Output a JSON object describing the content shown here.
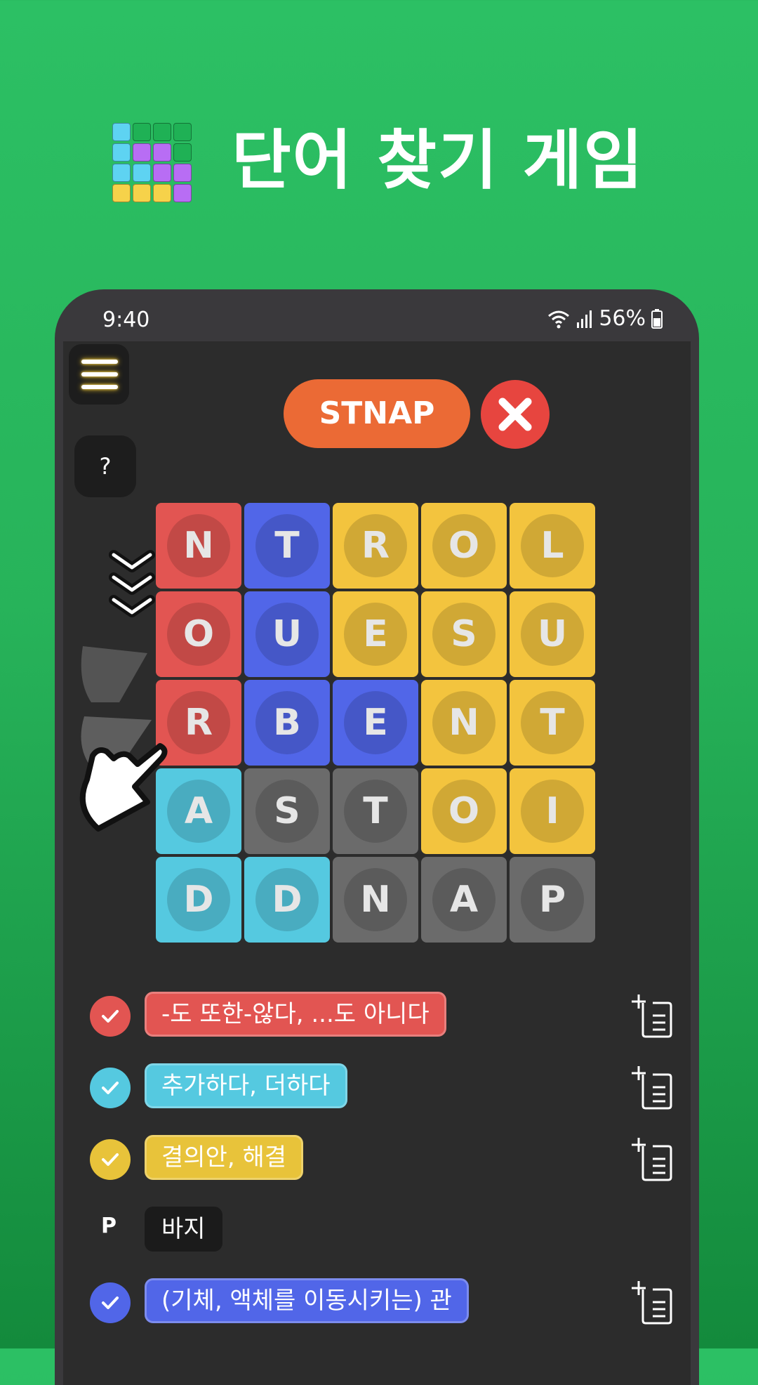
{
  "app": {
    "title": "단어 찾기 게임",
    "logo_icon": "grid-logo-icon"
  },
  "status": {
    "time": "9:40",
    "battery": "56%"
  },
  "game": {
    "current_word": "STNAP",
    "grid": [
      [
        "N",
        "T",
        "R",
        "O",
        "L"
      ],
      [
        "O",
        "U",
        "E",
        "S",
        "U"
      ],
      [
        "R",
        "B",
        "E",
        "N",
        "T"
      ],
      [
        "A",
        "S",
        "T",
        "O",
        "I"
      ],
      [
        "D",
        "D",
        "N",
        "A",
        "P"
      ]
    ],
    "colors": {
      "red": "#e25552",
      "blue": "#5166e8",
      "yellow": "#f3c43e",
      "cyan": "#55c9e0",
      "gray": "#6b6b6b"
    }
  },
  "words": [
    {
      "status": "found",
      "color": "#e25552",
      "text": "-도 또한-않다, ...도 아니다"
    },
    {
      "status": "found",
      "color": "#55c9e0",
      "text": "추가하다, 더하다"
    },
    {
      "status": "found",
      "color": "#e8c33a",
      "text": "결의안, 해결"
    },
    {
      "status": "hint",
      "letter": "P",
      "color": "#1b1b1b",
      "text": "바지"
    },
    {
      "status": "found",
      "color": "#5166e8",
      "text": "(기체, 액체를 이동시키는) 관"
    }
  ]
}
